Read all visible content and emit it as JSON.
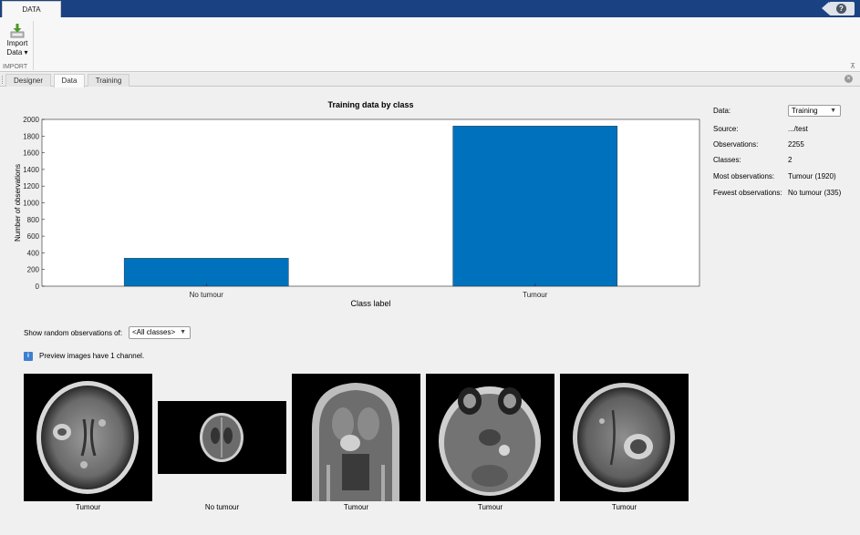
{
  "app": {
    "top_tab": "DATA",
    "help_label": "?"
  },
  "toolstrip": {
    "import_label_line1": "Import",
    "import_label_line2": "Data ▾",
    "section_label": "IMPORT",
    "collapse_glyph": "⊼"
  },
  "tabs": [
    {
      "label": "Designer",
      "active": false
    },
    {
      "label": "Data",
      "active": true
    },
    {
      "label": "Training",
      "active": false
    }
  ],
  "chart_data": {
    "type": "bar",
    "title": "Training data by class",
    "categories": [
      "No tumour",
      "Tumour"
    ],
    "values": [
      335,
      1920
    ],
    "xlabel": "Class label",
    "ylabel": "Number of observations",
    "ylim": [
      0,
      2000
    ],
    "yticks": [
      0,
      200,
      400,
      600,
      800,
      1000,
      1200,
      1400,
      1600,
      1800,
      2000
    ],
    "grid": false,
    "bar_color": "#0072bd"
  },
  "info": {
    "data_label": "Data:",
    "data_value": "Training",
    "source_label": "Source:",
    "source_value": ".../test",
    "observations_label": "Observations:",
    "observations_value": "2255",
    "classes_label": "Classes:",
    "classes_value": "2",
    "most_label": "Most observations:",
    "most_value": "Tumour (1920)",
    "fewest_label": "Fewest observations:",
    "fewest_value": "No tumour (335)"
  },
  "observations": {
    "label": "Show random observations of:",
    "dropdown_value": "<All classes>",
    "note": "Preview images have 1 channel.",
    "info_glyph": "i"
  },
  "thumbnails": [
    {
      "caption": "Tumour",
      "icon": "brain-axial-lesion-icon"
    },
    {
      "caption": "No tumour",
      "icon": "brain-axial-small-icon"
    },
    {
      "caption": "Tumour",
      "icon": "brain-coronal-icon"
    },
    {
      "caption": "Tumour",
      "icon": "brain-axial-skull-base-icon"
    },
    {
      "caption": "Tumour",
      "icon": "brain-axial-lesion-icon"
    }
  ],
  "colors": {
    "title_bar": "#1a4283",
    "accent": "#0072bd",
    "info_icon": "#3d7fd0"
  }
}
